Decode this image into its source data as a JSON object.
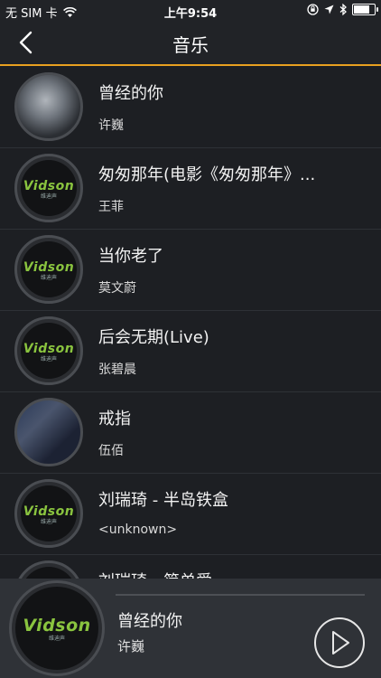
{
  "status": {
    "carrier": "无 SIM 卡",
    "time": "上午9:54"
  },
  "header": {
    "title": "音乐"
  },
  "songs": [
    {
      "title": "曾经的你",
      "artist": "许巍"
    },
    {
      "title": "匆匆那年(电影《匆匆那年》...",
      "artist": "王菲"
    },
    {
      "title": "当你老了",
      "artist": "莫文蔚"
    },
    {
      "title": "后会无期(Live)",
      "artist": "张碧晨"
    },
    {
      "title": "戒指",
      "artist": "伍佰"
    },
    {
      "title": "刘瑞琦 - 半岛铁盒",
      "artist": "<unknown>"
    },
    {
      "title": "刘瑞琦 - 简单爱",
      "artist": ""
    }
  ],
  "logo": {
    "text": "Vidson",
    "sub": "维迪声"
  },
  "player": {
    "title": "曾经的你",
    "artist": "许巍"
  },
  "colors": {
    "accent": "#e8a020",
    "logo_green": "#8ac43f",
    "background": "#1d1f23"
  }
}
